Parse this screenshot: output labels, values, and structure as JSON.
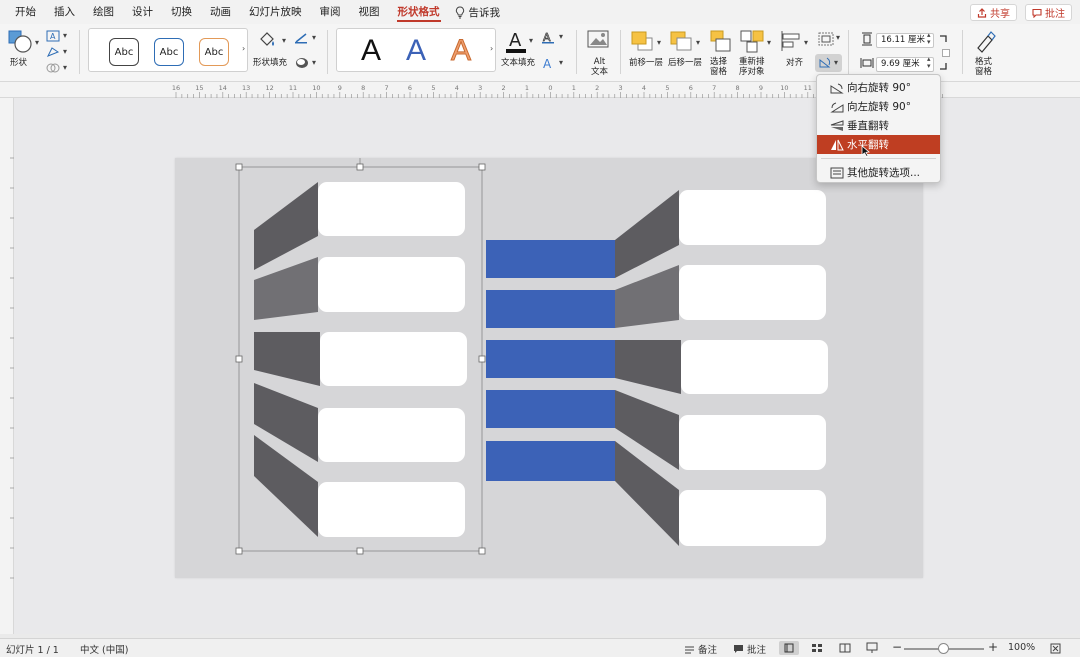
{
  "menu": {
    "tabs": [
      "开始",
      "插入",
      "绘图",
      "设计",
      "切换",
      "动画",
      "幻灯片放映",
      "审阅",
      "视图",
      "形状格式"
    ],
    "active_tab": "形状格式",
    "tell_me": "告诉我",
    "share": "共享",
    "comments": "批注"
  },
  "ribbon": {
    "shape_label": "形状",
    "shape_styles": [
      "Abc",
      "Abc",
      "Abc"
    ],
    "shape_fill_label": "形状填充",
    "wordart_letters": [
      "A",
      "A",
      "A"
    ],
    "text_fill_label": "文本填充",
    "alt_text_label_1": "Alt",
    "alt_text_label_2": "文本",
    "bring_forward_label": "前移一层",
    "send_backward_label": "后移一层",
    "selection_pane_label_1": "选择",
    "selection_pane_label_2": "窗格",
    "reorder_label_1": "重新排",
    "reorder_label_2": "序对象",
    "align_label": "对齐",
    "height_value": "16.11 厘米",
    "width_value": "9.69 厘米",
    "format_pane_label_1": "格式",
    "format_pane_label_2": "窗格"
  },
  "ruler": {
    "labels": [
      "16",
      "15",
      "14",
      "13",
      "12",
      "11",
      "10",
      "9",
      "8",
      "7",
      "6",
      "5",
      "4",
      "3",
      "2",
      "1",
      "0",
      "1",
      "2",
      "3",
      "4",
      "5",
      "6",
      "7",
      "8",
      "9",
      "10",
      "11",
      "12",
      "13",
      "14",
      "15",
      "16"
    ]
  },
  "rotate_menu": {
    "items": [
      {
        "label": "向右旋转 90°",
        "icon": "rotate-right-icon"
      },
      {
        "label": "向左旋转 90°",
        "icon": "rotate-left-icon"
      },
      {
        "label": "垂直翻转",
        "icon": "flip-vertical-icon"
      },
      {
        "label": "水平翻转",
        "icon": "flip-horizontal-icon",
        "highlighted": true
      }
    ],
    "more_options": "其他旋转选项..."
  },
  "status": {
    "slide_counter": "幻灯片 1 / 1",
    "language": "中文 (中国)",
    "notes": "备注",
    "comments": "批注",
    "zoom": "100%"
  },
  "colors": {
    "accent": "#c0392b",
    "highlight": "#bf3e22",
    "blue_bar": "#3c62b7",
    "dark_gray": "#5d5c60",
    "mid_gray": "#717074",
    "slide_bg": "#d6d6d8"
  }
}
